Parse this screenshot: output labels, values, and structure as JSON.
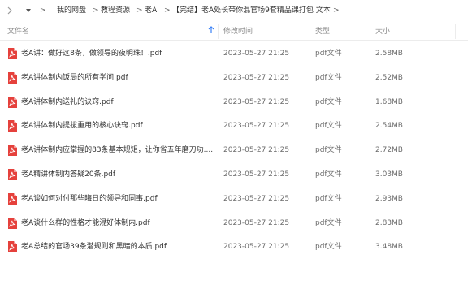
{
  "breadcrumb": {
    "items": [
      "我的网盘",
      "教程资源",
      "老A",
      "【完结】老A处长带你混官场9套精品课打包 文本"
    ],
    "separator": ">"
  },
  "columns": {
    "name": "文件名",
    "modified": "修改时间",
    "type": "类型",
    "size": "大小"
  },
  "files": [
    {
      "name": "老A讲：做好这8条，做领导的夜明珠！.pdf",
      "modified": "2023-05-27 21:25",
      "type": "pdf文件",
      "size": "2.58MB"
    },
    {
      "name": "老A讲体制内饭局的所有学问.pdf",
      "modified": "2023-05-27 21:25",
      "type": "pdf文件",
      "size": "2.52MB"
    },
    {
      "name": "老A讲体制内送礼的诀窍.pdf",
      "modified": "2023-05-27 21:25",
      "type": "pdf文件",
      "size": "1.68MB"
    },
    {
      "name": "老A讲体制内提拔重用的核心诀窍.pdf",
      "modified": "2023-05-27 21:25",
      "type": "pdf文件",
      "size": "2.54MB"
    },
    {
      "name": "老A讲体制内应掌握的83条基本规矩，让你省五年磨刀功....",
      "modified": "2023-05-27 21:25",
      "type": "pdf文件",
      "size": "2.72MB"
    },
    {
      "name": "老A精讲体制内答疑20条.pdf",
      "modified": "2023-05-27 21:25",
      "type": "pdf文件",
      "size": "3.03MB"
    },
    {
      "name": "老A谈如何对付那些晦日的领导和同事.pdf",
      "modified": "2023-05-27 21:25",
      "type": "pdf文件",
      "size": "2.93MB"
    },
    {
      "name": "老A谈什么样的性格才能混好体制内.pdf",
      "modified": "2023-05-27 21:25",
      "type": "pdf文件",
      "size": "2.83MB"
    },
    {
      "name": "老A总结的官场39条潜规则和黑暗的本质.pdf",
      "modified": "2023-05-27 21:25",
      "type": "pdf文件",
      "size": "3.48MB"
    }
  ],
  "colors": {
    "pdf_red": "#e5413c",
    "text": "#333333",
    "muted": "#8a8a8a"
  }
}
